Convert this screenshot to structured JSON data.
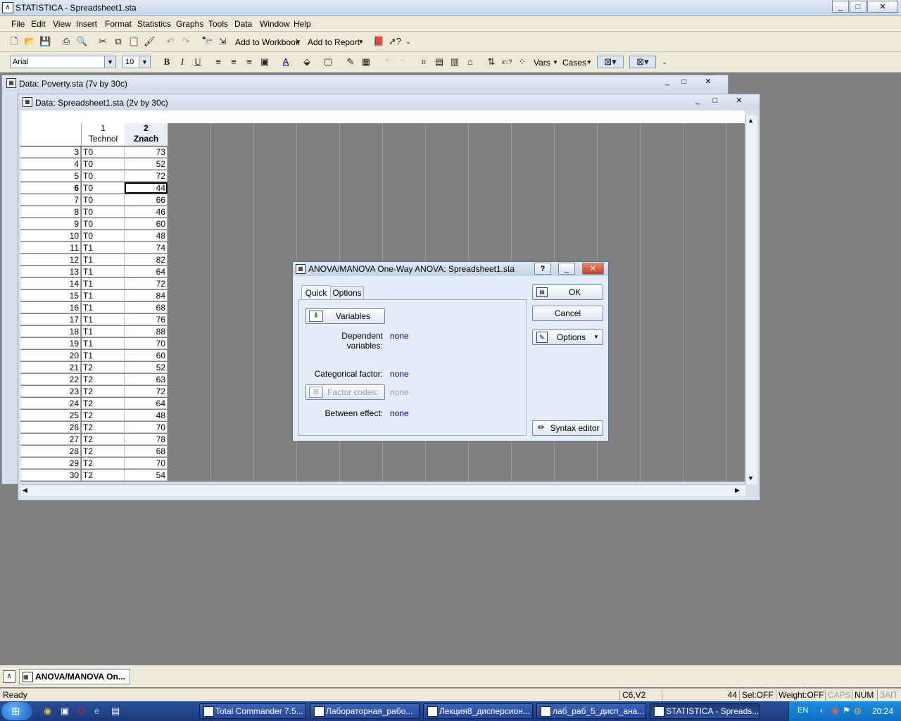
{
  "app": {
    "title": "STATISTICA - Spreadsheet1.sta",
    "window_controls": [
      "_",
      "□",
      "✕"
    ]
  },
  "menu": [
    "File",
    "Edit",
    "View",
    "Insert",
    "Format",
    "Statistics",
    "Graphs",
    "Tools",
    "Data",
    "Window",
    "Help"
  ],
  "toolbar": {
    "add_to_workbook": "Add to Workbook",
    "add_to_report": "Add to Report",
    "font_name": "Arial",
    "font_size": "10",
    "bold": "B",
    "italic": "I",
    "underline": "U",
    "vars": "Vars",
    "cases": "Cases"
  },
  "poverty_window": {
    "title": "Data: Poverty.sta (7v by 30c)"
  },
  "spreadsheet_window": {
    "title": "Data: Spreadsheet1.sta (2v by 30c)",
    "columns": [
      {
        "num": "1",
        "name": "Technol"
      },
      {
        "num": "2",
        "name": "Znach"
      }
    ],
    "rows": [
      {
        "n": "3",
        "a": "T0",
        "b": "73"
      },
      {
        "n": "4",
        "a": "T0",
        "b": "52"
      },
      {
        "n": "5",
        "a": "T0",
        "b": "72"
      },
      {
        "n": "6",
        "a": "T0",
        "b": "44"
      },
      {
        "n": "7",
        "a": "T0",
        "b": "66"
      },
      {
        "n": "8",
        "a": "T0",
        "b": "46"
      },
      {
        "n": "9",
        "a": "T0",
        "b": "60"
      },
      {
        "n": "10",
        "a": "T0",
        "b": "48"
      },
      {
        "n": "11",
        "a": "T1",
        "b": "74"
      },
      {
        "n": "12",
        "a": "T1",
        "b": "82"
      },
      {
        "n": "13",
        "a": "T1",
        "b": "64"
      },
      {
        "n": "14",
        "a": "T1",
        "b": "72"
      },
      {
        "n": "15",
        "a": "T1",
        "b": "84"
      },
      {
        "n": "16",
        "a": "T1",
        "b": "68"
      },
      {
        "n": "17",
        "a": "T1",
        "b": "76"
      },
      {
        "n": "18",
        "a": "T1",
        "b": "88"
      },
      {
        "n": "19",
        "a": "T1",
        "b": "70"
      },
      {
        "n": "20",
        "a": "T1",
        "b": "60"
      },
      {
        "n": "21",
        "a": "T2",
        "b": "52"
      },
      {
        "n": "22",
        "a": "T2",
        "b": "63"
      },
      {
        "n": "23",
        "a": "T2",
        "b": "72"
      },
      {
        "n": "24",
        "a": "T2",
        "b": "64"
      },
      {
        "n": "25",
        "a": "T2",
        "b": "48"
      },
      {
        "n": "26",
        "a": "T2",
        "b": "70"
      },
      {
        "n": "27",
        "a": "T2",
        "b": "78"
      },
      {
        "n": "28",
        "a": "T2",
        "b": "68"
      },
      {
        "n": "29",
        "a": "T2",
        "b": "70"
      },
      {
        "n": "30",
        "a": "T2",
        "b": "54"
      }
    ],
    "selected_case": "6"
  },
  "dialog": {
    "title": "ANOVA/MANOVA One-Way ANOVA: Spreadsheet1.sta",
    "help": "?",
    "tabs": [
      "Quick",
      "Options"
    ],
    "variables_button": "Variables",
    "dependent_label": "Dependent variables:",
    "dependent_value": "none",
    "categorical_label": "Categorical factor:",
    "categorical_value": "none",
    "factor_codes_button": "Factor codes:",
    "factor_codes_value": "none",
    "between_label": "Between effect:",
    "between_value": "none",
    "ok": "OK",
    "cancel": "Cancel",
    "options": "Options",
    "syntax_editor": "Syntax editor"
  },
  "mdi_taskbar": {
    "item": "ANOVA/MANOVA On..."
  },
  "status": {
    "ready": "Ready",
    "cell": "C6,V2",
    "value": "44",
    "sel": "Sel:OFF",
    "weight": "Weight:OFF",
    "caps": "CAPS",
    "num": "NUM",
    "zap": "ЗАП"
  },
  "os_taskbar": {
    "tasks": [
      "Total Commander 7.5...",
      "Лабораторная_рабо...",
      "Лекция8_дисперсион...",
      "лаб_раб_5_дисп_ана...",
      "STATISTICA - Spreads..."
    ],
    "lang": "EN",
    "time": "20:24"
  },
  "colors": {
    "mdi_background": "#808080",
    "dialog_value": "#00008b",
    "taskbar": "#24479a"
  }
}
